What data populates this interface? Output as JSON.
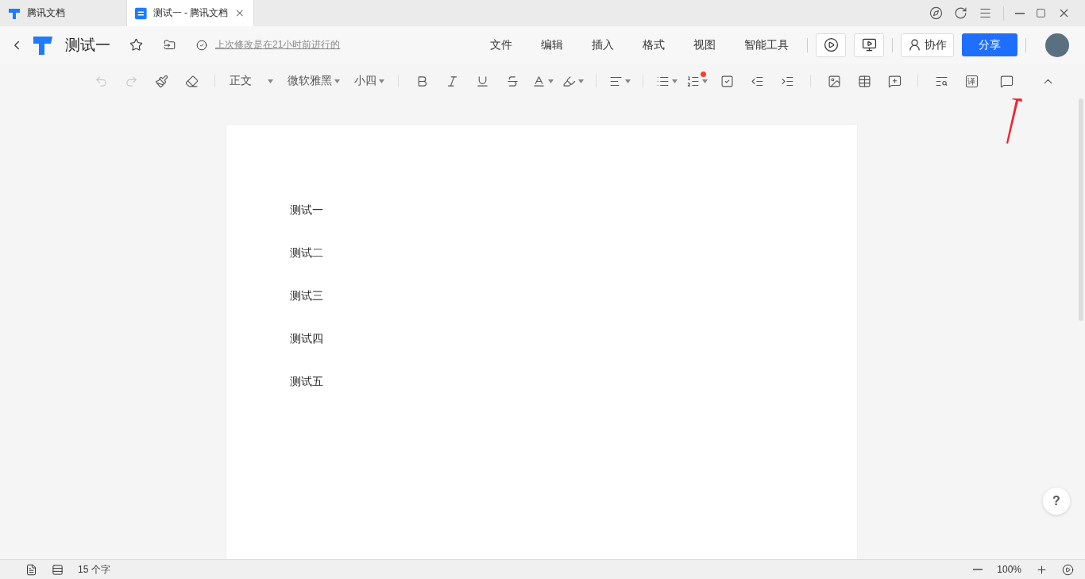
{
  "browser_tabs": [
    {
      "title": "腾讯文档",
      "selected": false,
      "kind": "app"
    },
    {
      "title": "测试一 - 腾讯文档",
      "selected": true,
      "kind": "doc"
    }
  ],
  "header": {
    "title": "测试一",
    "save_status": "上次修改是在21小时前进行的",
    "menu": [
      "文件",
      "编辑",
      "插入",
      "格式",
      "视图",
      "智能工具"
    ],
    "collab_button": "协作",
    "share_button": "分享"
  },
  "toolbar": {
    "undo": {
      "disabled": true
    },
    "redo": {
      "disabled": true
    },
    "paragraph_style": "正文",
    "font": "微软雅黑",
    "font_size": "小四",
    "numbered_list_notice": true,
    "translate_glyph": "译"
  },
  "document": {
    "paragraphs": [
      "测试一",
      "测试二",
      "测试三",
      "测试四",
      "测试五"
    ]
  },
  "help_button": "?",
  "status_bar": {
    "word_count": "15 个字",
    "zoom": "100%"
  }
}
